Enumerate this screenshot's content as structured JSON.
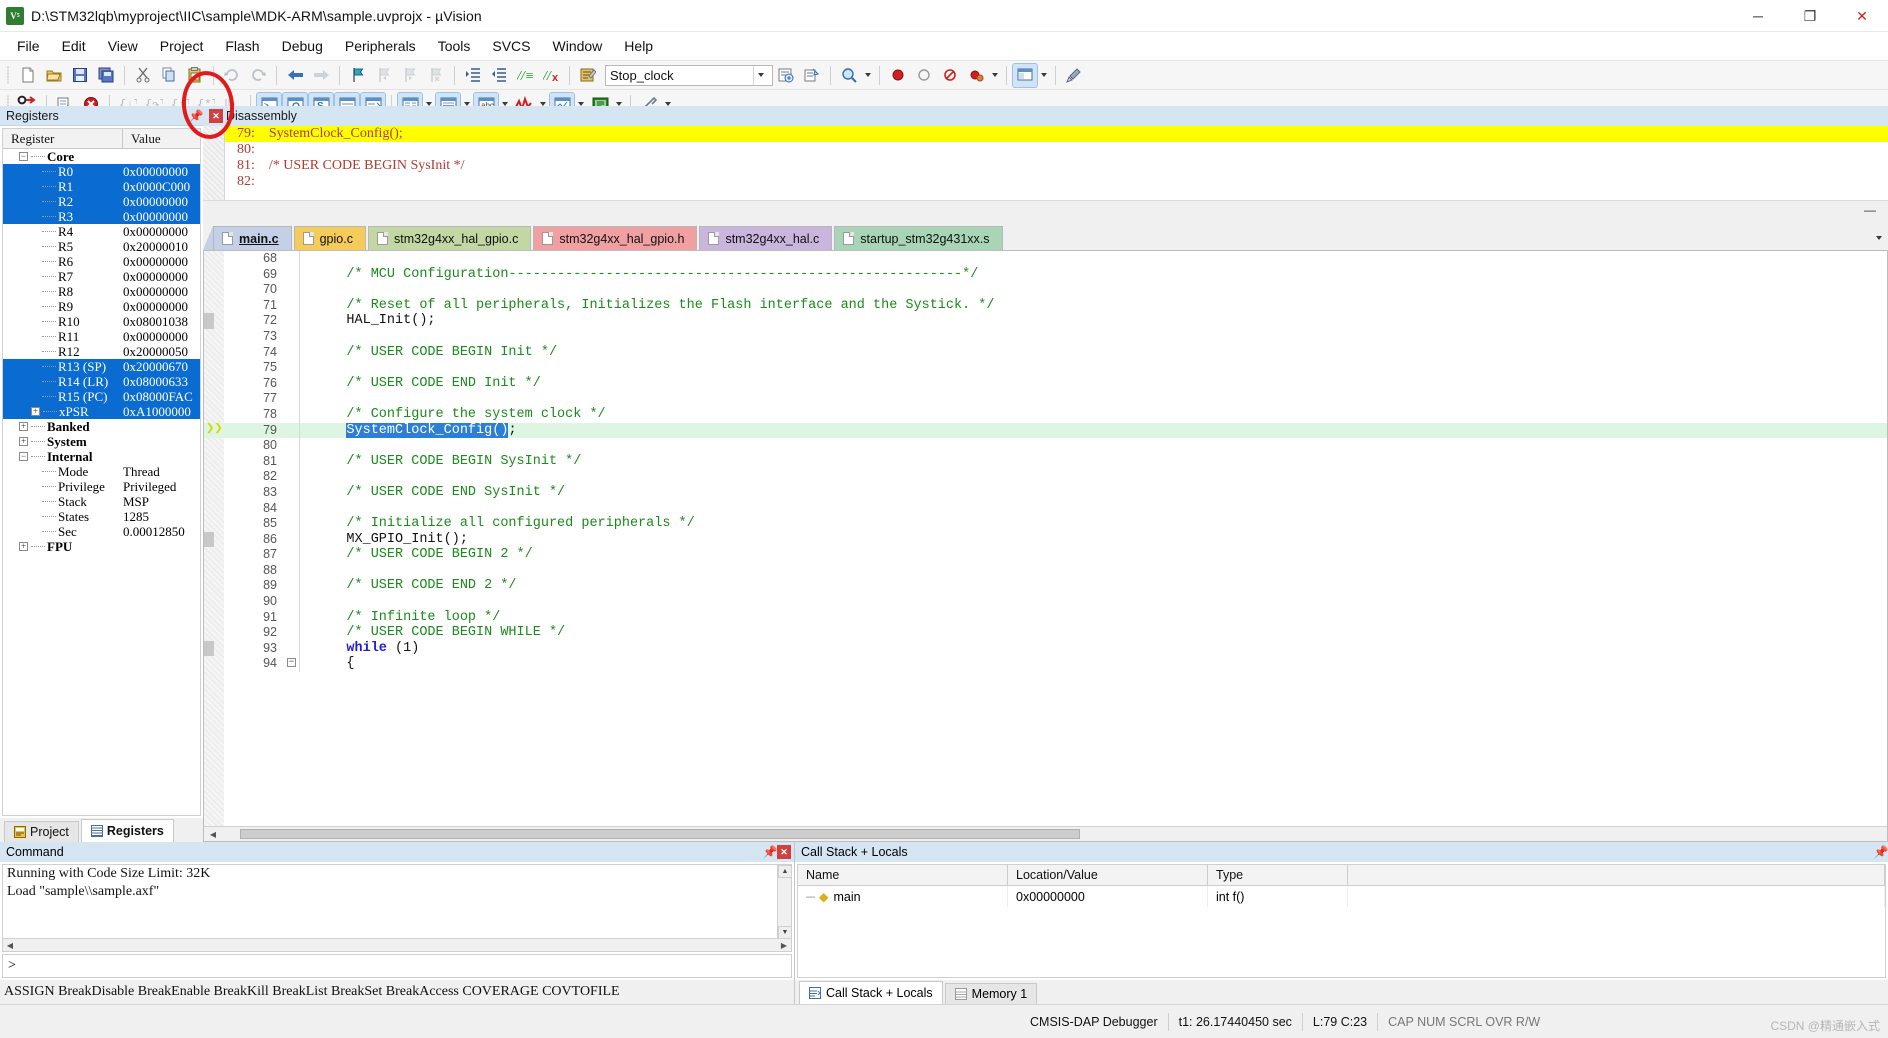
{
  "window": {
    "title": "D:\\STM32lqb\\myproject\\IIC\\sample\\MDK-ARM\\sample.uvprojx - µVision",
    "app_icon": "uvision-logo-icon",
    "minimize": "─",
    "maximize": "❐",
    "close": "✕"
  },
  "menu": {
    "items": [
      {
        "label": "File"
      },
      {
        "label": "Edit"
      },
      {
        "label": "View"
      },
      {
        "label": "Project"
      },
      {
        "label": "Flash"
      },
      {
        "label": "Debug"
      },
      {
        "label": "Peripherals"
      },
      {
        "label": "Tools"
      },
      {
        "label": "SVCS"
      },
      {
        "label": "Window"
      },
      {
        "label": "Help"
      }
    ]
  },
  "toolbar_main": {
    "combo_value": "Stop_clock",
    "items": [
      {
        "name": "new-file-icon",
        "tip": "New"
      },
      {
        "name": "open-file-icon",
        "tip": "Open"
      },
      {
        "name": "save-icon",
        "tip": "Save"
      },
      {
        "name": "save-all-icon",
        "tip": "Save All"
      },
      {
        "name": "cut-icon",
        "tip": "Cut"
      },
      {
        "name": "copy-icon",
        "tip": "Copy"
      },
      {
        "name": "paste-icon",
        "tip": "Paste"
      },
      {
        "name": "undo-icon",
        "tip": "Undo"
      },
      {
        "name": "redo-icon",
        "tip": "Redo"
      },
      {
        "name": "navigate-back-icon",
        "tip": "Back"
      },
      {
        "name": "navigate-forward-icon",
        "tip": "Forward"
      },
      {
        "name": "bookmark-toggle-icon",
        "tip": "Insert/Remove Bookmark"
      },
      {
        "name": "bookmark-prev-icon",
        "tip": "Previous Bookmark"
      },
      {
        "name": "bookmark-next-icon",
        "tip": "Next Bookmark"
      },
      {
        "name": "bookmark-clear-icon",
        "tip": "Clear All Bookmarks"
      },
      {
        "name": "indent-icon",
        "tip": "Indent"
      },
      {
        "name": "outdent-icon",
        "tip": "Outdent"
      },
      {
        "name": "comment-icon",
        "tip": "Comment"
      },
      {
        "name": "uncomment-icon",
        "tip": "Uncomment"
      },
      {
        "name": "build-icon",
        "tip": "Build"
      }
    ],
    "right_items": [
      {
        "name": "target-options-icon"
      },
      {
        "name": "manage-project-icon"
      },
      {
        "name": "zoom-icon"
      },
      {
        "name": "breakpoint-insert-icon"
      },
      {
        "name": "breakpoint-disable-icon"
      },
      {
        "name": "breakpoint-kill-icon"
      },
      {
        "name": "breakpoint-disable-all-icon"
      },
      {
        "name": "window-layout-icon"
      },
      {
        "name": "configure-icon"
      }
    ]
  },
  "toolbar_debug": {
    "items": [
      {
        "name": "reset-cpu-icon",
        "label": "RST"
      },
      {
        "name": "run-icon"
      },
      {
        "name": "stop-icon"
      },
      {
        "name": "step-into-icon"
      },
      {
        "name": "step-over-icon"
      },
      {
        "name": "step-out-icon"
      },
      {
        "name": "run-to-cursor-icon"
      },
      {
        "name": "show-next-statement-icon"
      },
      {
        "name": "command-window-icon"
      },
      {
        "name": "disassembly-window-icon"
      },
      {
        "name": "symbols-window-icon"
      },
      {
        "name": "registers-window-icon"
      },
      {
        "name": "call-stack-window-icon"
      },
      {
        "name": "watch-window-icon"
      },
      {
        "name": "memory-window-icon"
      },
      {
        "name": "serial-window-icon"
      },
      {
        "name": "analysis-window-icon"
      },
      {
        "name": "trace-window-icon"
      },
      {
        "name": "system-viewer-icon"
      },
      {
        "name": "toolbox-icon"
      }
    ]
  },
  "registers_pane": {
    "title": "Registers",
    "columns": [
      "Register",
      "Value"
    ],
    "groups": [
      {
        "name": "Core",
        "expanded": true,
        "rows": [
          {
            "name": "R0",
            "value": "0x00000000",
            "selected": true
          },
          {
            "name": "R1",
            "value": "0x0000C000",
            "selected": true
          },
          {
            "name": "R2",
            "value": "0x00000000",
            "selected": true
          },
          {
            "name": "R3",
            "value": "0x00000000",
            "selected": true
          },
          {
            "name": "R4",
            "value": "0x00000000",
            "selected": false
          },
          {
            "name": "R5",
            "value": "0x20000010",
            "selected": false
          },
          {
            "name": "R6",
            "value": "0x00000000",
            "selected": false
          },
          {
            "name": "R7",
            "value": "0x00000000",
            "selected": false
          },
          {
            "name": "R8",
            "value": "0x00000000",
            "selected": false
          },
          {
            "name": "R9",
            "value": "0x00000000",
            "selected": false
          },
          {
            "name": "R10",
            "value": "0x08001038",
            "selected": false
          },
          {
            "name": "R11",
            "value": "0x00000000",
            "selected": false
          },
          {
            "name": "R12",
            "value": "0x20000050",
            "selected": false
          },
          {
            "name": "R13 (SP)",
            "value": "0x20000670",
            "selected": true
          },
          {
            "name": "R14 (LR)",
            "value": "0x08000633",
            "selected": true
          },
          {
            "name": "R15 (PC)",
            "value": "0x08000FAC",
            "selected": true
          },
          {
            "name": "xPSR",
            "value": "0xA1000000",
            "selected": true,
            "expandable": true
          }
        ]
      },
      {
        "name": "Banked",
        "expanded": false,
        "rows": []
      },
      {
        "name": "System",
        "expanded": false,
        "rows": []
      },
      {
        "name": "Internal",
        "expanded": true,
        "rows": [
          {
            "name": "Mode",
            "value": "Thread"
          },
          {
            "name": "Privilege",
            "value": "Privileged"
          },
          {
            "name": "Stack",
            "value": "MSP"
          },
          {
            "name": "States",
            "value": "1285"
          },
          {
            "name": "Sec",
            "value": "0.00012850"
          }
        ]
      },
      {
        "name": "FPU",
        "expanded": false,
        "rows": []
      }
    ],
    "tabs": [
      {
        "label": "Project",
        "icon": "project-icon",
        "active": false
      },
      {
        "label": "Registers",
        "icon": "registers-icon",
        "active": true
      }
    ]
  },
  "disassembly": {
    "title": "Disassembly",
    "lines": [
      {
        "text": "79:    SystemClock_Config();",
        "highlight": true
      },
      {
        "text": "80:",
        "highlight": false
      },
      {
        "text": "81:    /* USER CODE BEGIN SysInit */",
        "highlight": false
      },
      {
        "text": "82:",
        "highlight": false
      }
    ]
  },
  "file_tabs": [
    {
      "label": "main.c",
      "color": "#c3d0e8",
      "active": true
    },
    {
      "label": "gpio.c",
      "color": "#f5cc5a",
      "active": false
    },
    {
      "label": "stm32g4xx_hal_gpio.c",
      "color": "#c3d7a4",
      "active": false
    },
    {
      "label": "stm32g4xx_hal_gpio.h",
      "color": "#f0a0a0",
      "active": false
    },
    {
      "label": "stm32g4xx_hal.c",
      "color": "#c9b5dd",
      "active": false
    },
    {
      "label": "startup_stm32g431xx.s",
      "color": "#a8d5b5",
      "active": false
    }
  ],
  "editor": {
    "lines": [
      {
        "num": "68",
        "segments": []
      },
      {
        "num": "69",
        "segments": [
          {
            "t": "    /* MCU Configuration--------------------------------------------------------*/",
            "k": "com"
          }
        ]
      },
      {
        "num": "70",
        "segments": []
      },
      {
        "num": "71",
        "segments": [
          {
            "t": "    /* Reset of all peripherals, Initializes the Flash interface and the Systick. */",
            "k": "com"
          }
        ]
      },
      {
        "num": "72",
        "segments": [
          {
            "t": "    HAL_Init();",
            "k": "pl"
          }
        ],
        "modified": true
      },
      {
        "num": "73",
        "segments": []
      },
      {
        "num": "74",
        "segments": [
          {
            "t": "    /* USER CODE BEGIN Init */",
            "k": "com"
          }
        ]
      },
      {
        "num": "75",
        "segments": []
      },
      {
        "num": "76",
        "segments": [
          {
            "t": "    /* USER CODE END Init */",
            "k": "com"
          }
        ]
      },
      {
        "num": "77",
        "segments": []
      },
      {
        "num": "78",
        "segments": [
          {
            "t": "    /* Configure the system clock */",
            "k": "com"
          }
        ]
      },
      {
        "num": "79",
        "segments": [
          {
            "t": "    ",
            "k": "pl"
          },
          {
            "t": "SystemClock_Config()",
            "k": "sel"
          },
          {
            "t": ";",
            "k": "pl"
          }
        ],
        "current": true,
        "pc": true
      },
      {
        "num": "80",
        "segments": []
      },
      {
        "num": "81",
        "segments": [
          {
            "t": "    /* USER CODE BEGIN SysInit */",
            "k": "com"
          }
        ]
      },
      {
        "num": "82",
        "segments": []
      },
      {
        "num": "83",
        "segments": [
          {
            "t": "    /* USER CODE END SysInit */",
            "k": "com"
          }
        ]
      },
      {
        "num": "84",
        "segments": []
      },
      {
        "num": "85",
        "segments": [
          {
            "t": "    /* Initialize all configured peripherals */",
            "k": "com"
          }
        ]
      },
      {
        "num": "86",
        "segments": [
          {
            "t": "    MX_GPIO_Init();",
            "k": "pl"
          }
        ],
        "modified": true
      },
      {
        "num": "87",
        "segments": [
          {
            "t": "    /* USER CODE BEGIN 2 */",
            "k": "com"
          }
        ]
      },
      {
        "num": "88",
        "segments": []
      },
      {
        "num": "89",
        "segments": [
          {
            "t": "    /* USER CODE END 2 */",
            "k": "com"
          }
        ]
      },
      {
        "num": "90",
        "segments": []
      },
      {
        "num": "91",
        "segments": [
          {
            "t": "    /* Infinite loop */",
            "k": "com"
          }
        ]
      },
      {
        "num": "92",
        "segments": [
          {
            "t": "    /* USER CODE BEGIN WHILE */",
            "k": "com"
          }
        ]
      },
      {
        "num": "93",
        "segments": [
          {
            "t": "    ",
            "k": "pl"
          },
          {
            "t": "while",
            "k": "kw"
          },
          {
            "t": " (1)",
            "k": "pl"
          }
        ],
        "modified": true
      },
      {
        "num": "94",
        "segments": [
          {
            "t": "    {",
            "k": "pl"
          }
        ],
        "fold": true
      }
    ]
  },
  "command_pane": {
    "title": "Command",
    "output": [
      "Running with Code Size Limit: 32K",
      "Load \"sample\\\\sample.axf\""
    ],
    "prompt": ">",
    "input_value": "",
    "keywords": "ASSIGN BreakDisable BreakEnable BreakKill BreakList BreakSet BreakAccess COVERAGE COVTOFILE"
  },
  "callstack_pane": {
    "title": "Call Stack + Locals",
    "columns": [
      "Name",
      "Location/Value",
      "Type"
    ],
    "rows": [
      {
        "name": "main",
        "location": "0x00000000",
        "type": "int f()"
      }
    ],
    "tabs": [
      {
        "label": "Call Stack + Locals",
        "icon": "callstack-icon",
        "active": true
      },
      {
        "label": "Memory 1",
        "icon": "memory-icon",
        "active": false
      }
    ]
  },
  "statusbar": {
    "debugger": "CMSIS-DAP Debugger",
    "time": "t1: 26.17440450 sec",
    "caret": "L:79 C:23",
    "keys": "CAP NUM SCRL OVR R/W"
  },
  "watermark": "CSDN @精通嵌入式",
  "colors": {
    "accent": "#d6e5f2",
    "selection": "#0a6cd0",
    "highlight_yellow": "#ffff00",
    "current_line": "#ddf5e2",
    "comment_green": "#1a8a1a",
    "keyword_blue": "#2020d0",
    "annotation_red": "#e01b1b"
  }
}
